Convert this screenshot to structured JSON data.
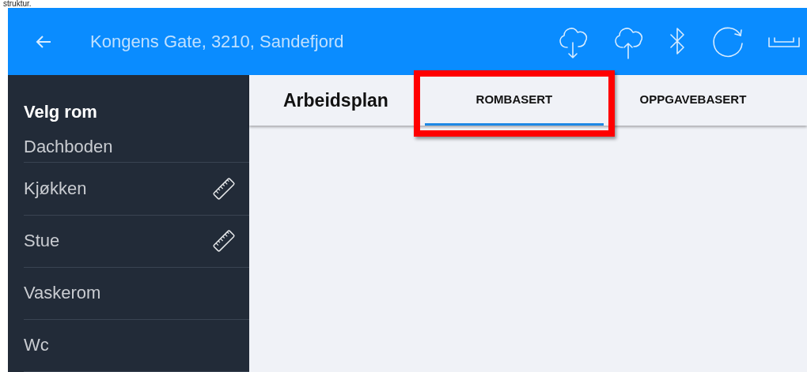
{
  "caption": "struktur.",
  "header": {
    "title": "Kongens Gate, 3210, Sandefjord",
    "actions": [
      {
        "kind": "cloud-download"
      },
      {
        "kind": "cloud-upload"
      },
      {
        "kind": "bluetooth"
      },
      {
        "kind": "refresh"
      },
      {
        "kind": "tray"
      }
    ]
  },
  "sidebar": {
    "title": "Velg rom",
    "items": [
      {
        "label": "Dachboden",
        "measured": false
      },
      {
        "label": "Kjøkken",
        "measured": true
      },
      {
        "label": "Stue",
        "measured": true
      },
      {
        "label": "Vaskerom",
        "measured": false
      },
      {
        "label": "Wc",
        "measured": false
      }
    ]
  },
  "toolbar": {
    "title": "Arbeidsplan",
    "tabs": [
      {
        "label": "ROMBASERT",
        "selected": true,
        "highlighted": true
      },
      {
        "label": "OPPGAVEBASERT",
        "selected": false,
        "highlighted": false
      }
    ]
  }
}
